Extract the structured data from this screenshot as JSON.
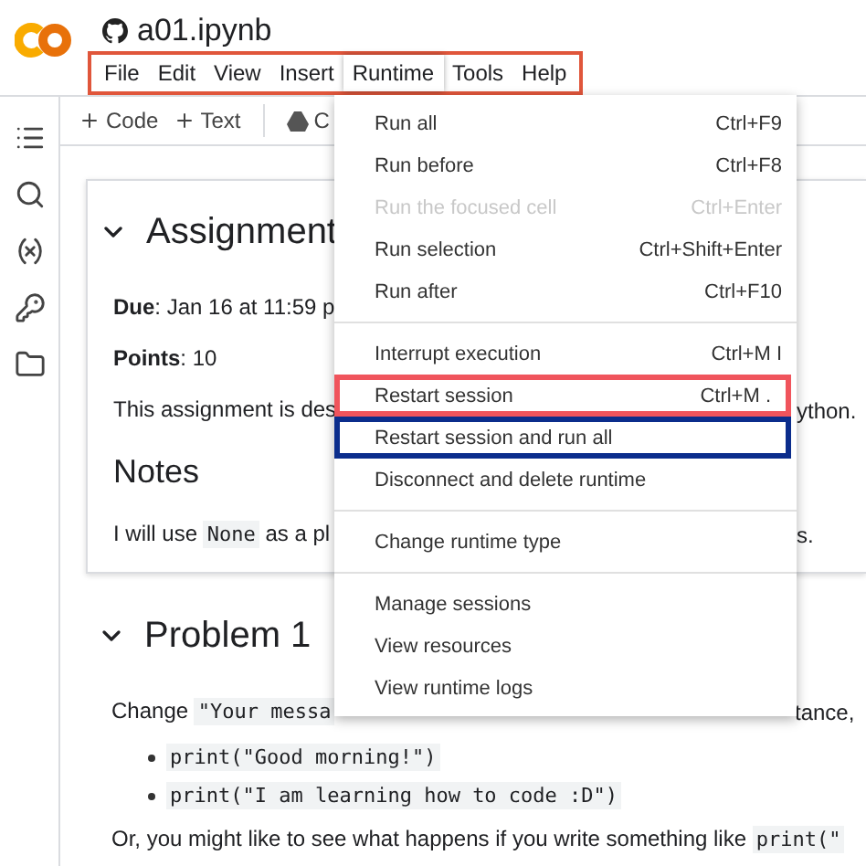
{
  "app": {
    "title": "a01.ipynb"
  },
  "menubar": [
    {
      "label": "File",
      "selected": false
    },
    {
      "label": "Edit",
      "selected": false
    },
    {
      "label": "View",
      "selected": false
    },
    {
      "label": "Insert",
      "selected": false
    },
    {
      "label": "Runtime",
      "selected": true
    },
    {
      "label": "Tools",
      "selected": false
    },
    {
      "label": "Help",
      "selected": false
    }
  ],
  "toolbar": [
    {
      "kind": "add",
      "label": "Code"
    },
    {
      "kind": "add",
      "label": "Text"
    },
    {
      "kind": "drive",
      "label": "C"
    }
  ],
  "card": [
    {
      "kind": "heading",
      "expanded": true,
      "text": "Assignment"
    },
    {
      "kind": "paragraph",
      "segments": [
        {
          "kind": "text",
          "text": "**Due**: Jan 16 at 11:59 p"
        }
      ]
    },
    {
      "kind": "paragraph",
      "segments": [
        {
          "kind": "text",
          "text": "**Points**: 10"
        }
      ]
    },
    {
      "kind": "paragraph",
      "segments": [
        {
          "kind": "text",
          "text": "This assignment is des"
        }
      ],
      "right": "ython."
    },
    {
      "kind": "subheading",
      "text": "Notes"
    },
    {
      "kind": "paragraph",
      "segments": [
        {
          "kind": "text",
          "text": "I will use "
        },
        {
          "kind": "code",
          "text": "None"
        },
        {
          "kind": "text",
          "text": " as a pl"
        }
      ],
      "right": "s."
    }
  ],
  "cells": [
    {
      "kind": "heading",
      "expanded": true,
      "text": "Problem 1"
    },
    {
      "kind": "paragraph",
      "segments": [
        {
          "kind": "text",
          "text": "Change "
        },
        {
          "kind": "code",
          "text": "\"Your messa"
        }
      ],
      "right": "tance,"
    },
    {
      "kind": "bullet",
      "segments": [
        {
          "kind": "code",
          "text": "print(\"Good morning!\")"
        }
      ]
    },
    {
      "kind": "bullet",
      "segments": [
        {
          "kind": "code",
          "text": "print(\"I am learning how to code :D\")"
        }
      ]
    },
    {
      "kind": "paragraph",
      "segments": [
        {
          "kind": "text",
          "text": "Or, you might like to see what happens if you write something like "
        },
        {
          "kind": "code",
          "text": "print(\""
        }
      ]
    }
  ],
  "menu": [
    {
      "kind": "item",
      "label": "Run all",
      "shortcut": "Ctrl+F9",
      "disabled": false
    },
    {
      "kind": "item",
      "label": "Run before",
      "shortcut": "Ctrl+F8",
      "disabled": false
    },
    {
      "kind": "item",
      "label": "Run the focused cell",
      "shortcut": "Ctrl+Enter",
      "disabled": true
    },
    {
      "kind": "item",
      "label": "Run selection",
      "shortcut": "Ctrl+Shift+Enter",
      "disabled": false
    },
    {
      "kind": "item",
      "label": "Run after",
      "shortcut": "Ctrl+F10",
      "disabled": false
    },
    {
      "kind": "divider"
    },
    {
      "kind": "item",
      "label": "Interrupt execution",
      "shortcut": "Ctrl+M I",
      "disabled": false
    },
    {
      "kind": "item",
      "label": "Restart session",
      "shortcut": "Ctrl+M .",
      "disabled": false,
      "color": "#f0545c"
    },
    {
      "kind": "item",
      "label": "Restart session and run all",
      "disabled": false,
      "color": "#0b2d8c"
    },
    {
      "kind": "item",
      "label": "Disconnect and delete runtime",
      "disabled": false
    },
    {
      "kind": "divider"
    },
    {
      "kind": "item",
      "label": "Change runtime type",
      "disabled": false
    },
    {
      "kind": "divider"
    },
    {
      "kind": "item",
      "label": "Manage sessions",
      "disabled": false
    },
    {
      "kind": "item",
      "label": "View resources",
      "disabled": false
    },
    {
      "kind": "item",
      "label": "View runtime logs",
      "disabled": false
    }
  ]
}
